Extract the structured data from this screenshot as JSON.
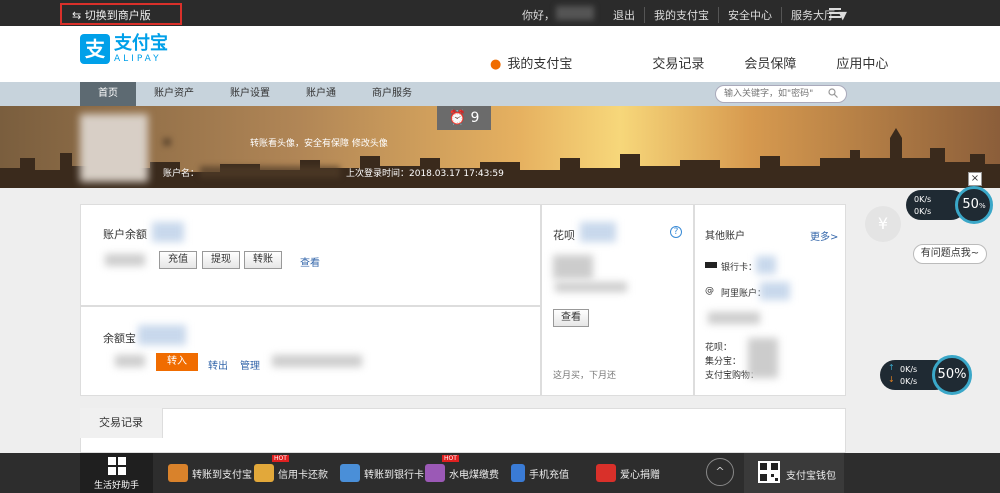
{
  "topbar": {
    "switch_label": "切换到商户版",
    "hello": "你好，",
    "links": [
      "退出",
      "我的支付宝",
      "安全中心",
      "服务大厅 ▼"
    ]
  },
  "header": {
    "logo_cn": "支付宝",
    "logo_en": "ALIPAY",
    "logo_mark": "支",
    "nav": [
      "我的支付宝",
      "交易记录",
      "会员保障",
      "应用中心"
    ]
  },
  "subnav": {
    "items": [
      "首页",
      "账户资产",
      "账户设置",
      "账户通",
      "商户服务"
    ],
    "search_placeholder": "输入关键字，如\"密码\""
  },
  "banner": {
    "alarm_count": "9",
    "avatar_hint": "转账看头像，安全有保障 修改头像",
    "account_label": "账户名：",
    "last_login": "上次登录时间：2018.03.17 17:43:59"
  },
  "balance": {
    "title": "账户余额",
    "buttons": [
      "充值",
      "提现",
      "转账"
    ],
    "view_link": "查看"
  },
  "yuebao": {
    "title": "余额宝",
    "in_button": "转入",
    "out_link": "转出",
    "manage_link": "管理"
  },
  "huabei": {
    "title": "花呗",
    "view_button": "查看",
    "footer": "这月买，下月还"
  },
  "other": {
    "title": "其他账户",
    "more": "更多>",
    "bank": "银行卡：",
    "ali": "阿里账户：",
    "lines": [
      "花呗：",
      "集分宝：",
      "支付宝购物："
    ]
  },
  "tx": {
    "tab": "交易记录"
  },
  "widgets": {
    "speed1_up": "0K/s",
    "speed1_down": "0K/s",
    "pct1": "50",
    "pct1_unit": "%",
    "hint": "有问题点我~",
    "yen": "¥",
    "speed2_up": "0K/s",
    "speed2_down": "0K/s",
    "pct2": "50%"
  },
  "bottombar": {
    "life": "生活好助手",
    "items": [
      "转账到支付宝",
      "信用卡还款",
      "转账到银行卡",
      "水电煤缴费",
      "手机充值",
      "爱心捐赠"
    ],
    "hot": "HOT",
    "wallet": "支付宝钱包",
    "up": "^"
  }
}
